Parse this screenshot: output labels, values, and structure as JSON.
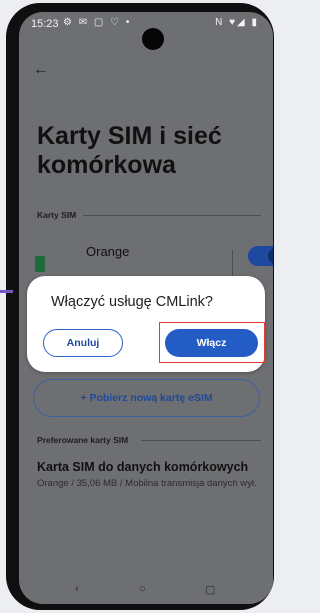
{
  "status_bar": {
    "time": "15:23",
    "left_icons": "⚙ ✉ ▢ ♡ •",
    "right_icons": "N ♥◢ ▮"
  },
  "page": {
    "title": "Karty SIM i sieć komórkowa"
  },
  "sections": {
    "sim_cards_label": "Karty SIM",
    "preferred_label": "Preferowane karty SIM"
  },
  "sim_card": {
    "name": "Orange",
    "enabled": true
  },
  "dialog": {
    "title": "Włączyć usługę CMLink?",
    "cancel_label": "Anuluj",
    "confirm_label": "Włącz"
  },
  "esim_button_label": "+ Pobierz nową kartę eSIM",
  "preferred_data_sim": {
    "title": "Karta SIM do danych komórkowych",
    "subtitle": "Orange / 35,06 MB / Mobilna transmisja danych wył."
  },
  "nav_icons": {
    "back": "‹",
    "home": "○",
    "recents": "▢"
  },
  "colors": {
    "accent": "#245cc6",
    "highlight_box": "#e53935",
    "scrim": "#6d6f72"
  }
}
